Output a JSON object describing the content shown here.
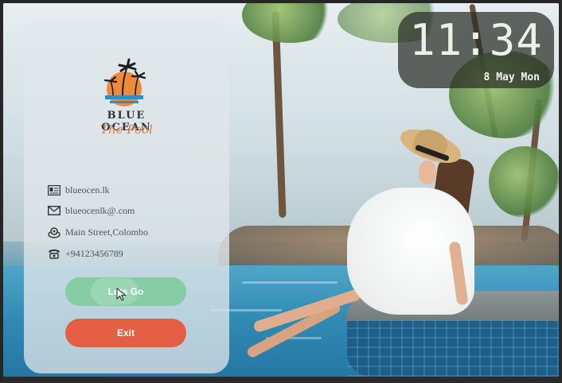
{
  "app": {
    "brand": "BLUE OCEAN",
    "subtitle": "The Pool"
  },
  "contact": {
    "website": "blueocen.lk",
    "email": "blueocenlk@.com",
    "address": "Main Street,Colombo",
    "phone": "+94123456789"
  },
  "buttons": {
    "lets_go": "Lets Go",
    "exit": "Exit"
  },
  "clock": {
    "time": "11:34",
    "date": "8 May Mon"
  },
  "icons": {
    "website": "id-card-icon",
    "email": "envelope-icon",
    "address": "location-pin-icon",
    "phone": "telephone-icon",
    "logo": "palm-sunset-logo",
    "cursor": "mouse-pointer-icon"
  },
  "colors": {
    "lets_go_button": "#86cca4",
    "exit_button": "#e55d43",
    "brand_text": "#30323a",
    "script_text": "#e07b3c",
    "clock_bg": "#2c2f28"
  }
}
